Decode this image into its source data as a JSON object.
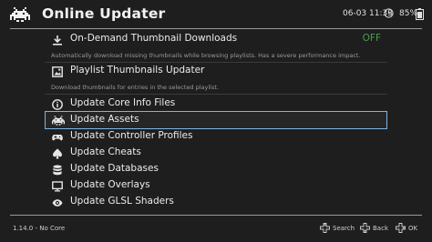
{
  "app": {
    "title": "Online Updater",
    "datetime": "06-03 11:33",
    "battery": "85%",
    "logo_icon": "retroarch-invader-icon",
    "clock_icon": "clock-icon",
    "battery_icon": "battery-icon"
  },
  "menu": {
    "thumbnail_downloads": {
      "label": "On-Demand Thumbnail Downloads",
      "value": "OFF",
      "description": "Automatically download missing thumbnails while browsing playlists. Has a severe performance impact.",
      "icon": "download-icon"
    },
    "playlist_thumbnails": {
      "label": "Playlist Thumbnails Updater",
      "description": "Download thumbnails for entries in the selected playlist.",
      "icon": "image-icon"
    },
    "core_info": {
      "label": "Update Core Info Files",
      "icon": "info-icon"
    },
    "assets": {
      "label": "Update Assets",
      "icon": "invader-icon",
      "selected": true
    },
    "controller_profiles": {
      "label": "Update Controller Profiles",
      "icon": "gamepad-icon"
    },
    "cheats": {
      "label": "Update Cheats",
      "icon": "spade-icon"
    },
    "databases": {
      "label": "Update Databases",
      "icon": "database-icon"
    },
    "overlays": {
      "label": "Update Overlays",
      "icon": "monitor-icon"
    },
    "glsl_shaders": {
      "label": "Update GLSL Shaders",
      "icon": "eye-icon"
    }
  },
  "footer": {
    "version": "1.14.0 - No Core",
    "search": "Search",
    "back": "Back",
    "ok": "OK"
  },
  "colors": {
    "background": "#1e1e1e",
    "selection_border": "#7fb4e0",
    "off_value": "#4a9c4a",
    "text": "#ececec",
    "subtext": "#9a9a9a"
  }
}
